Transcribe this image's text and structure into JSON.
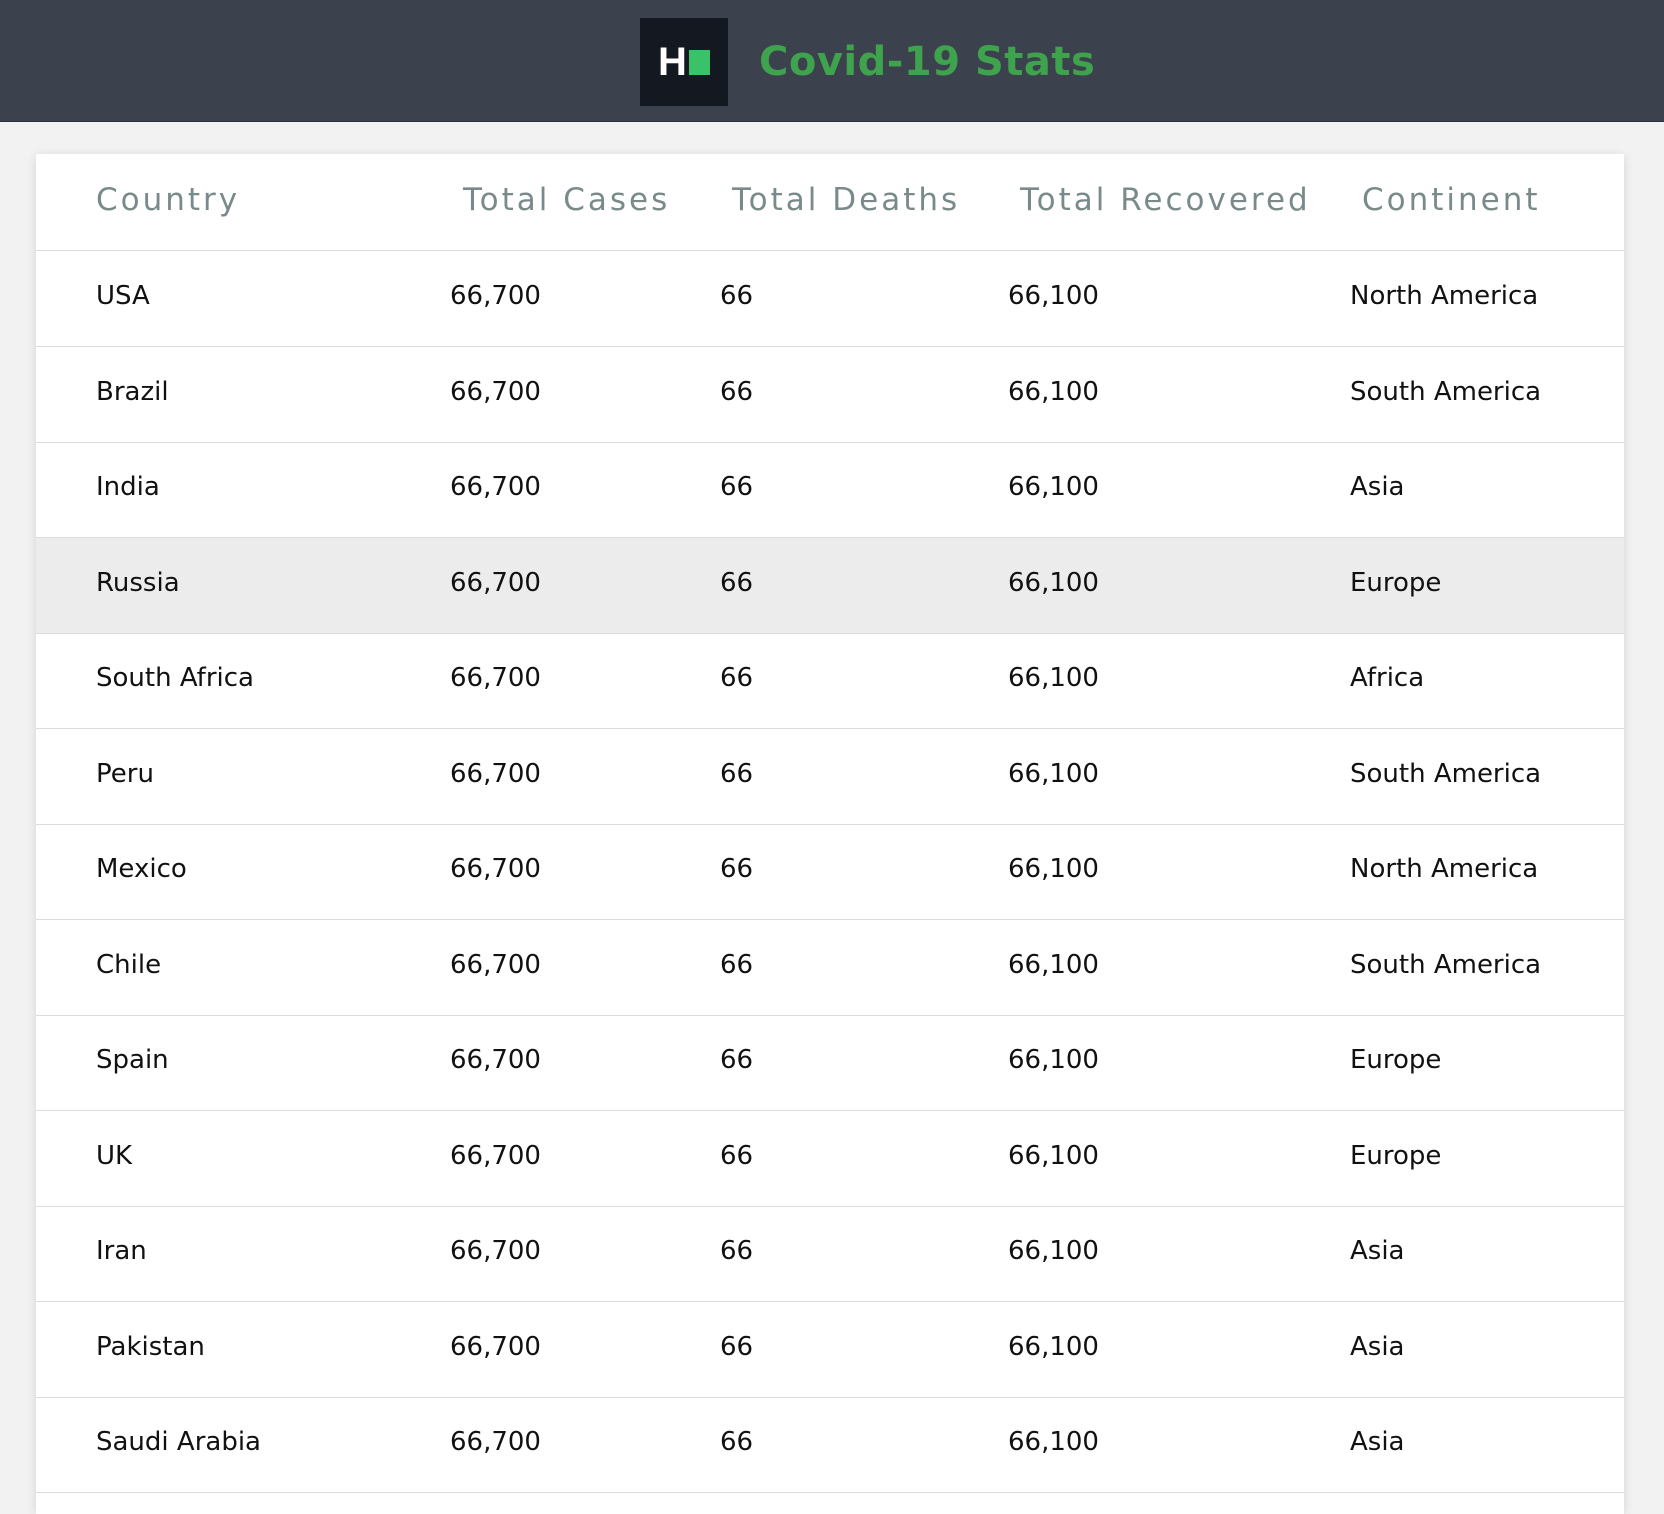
{
  "app": {
    "title": "Covid-19 Stats",
    "logo_letter": "H",
    "colors": {
      "header_bg": "#3b424d",
      "title": "#3fa34d",
      "logo_square": "#39c267"
    }
  },
  "table": {
    "headers": [
      "Country",
      "Total Cases",
      "Total Deaths",
      "Total Recovered",
      "Continent"
    ],
    "highlighted_row": 3,
    "rows": [
      [
        "USA",
        "66,700",
        "66",
        "66,100",
        "North America"
      ],
      [
        "Brazil",
        "66,700",
        "66",
        "66,100",
        "South America"
      ],
      [
        "India",
        "66,700",
        "66",
        "66,100",
        "Asia"
      ],
      [
        "Russia",
        "66,700",
        "66",
        "66,100",
        "Europe"
      ],
      [
        "South Africa",
        "66,700",
        "66",
        "66,100",
        "Africa"
      ],
      [
        "Peru",
        "66,700",
        "66",
        "66,100",
        "South America"
      ],
      [
        "Mexico",
        "66,700",
        "66",
        "66,100",
        "North America"
      ],
      [
        "Chile",
        "66,700",
        "66",
        "66,100",
        "South America"
      ],
      [
        "Spain",
        "66,700",
        "66",
        "66,100",
        "Europe"
      ],
      [
        "UK",
        "66,700",
        "66",
        "66,100",
        "Europe"
      ],
      [
        "Iran",
        "66,700",
        "66",
        "66,100",
        "Asia"
      ],
      [
        "Pakistan",
        "66,700",
        "66",
        "66,100",
        "Asia"
      ],
      [
        "Saudi Arabia",
        "66,700",
        "66",
        "66,100",
        "Asia"
      ]
    ]
  }
}
